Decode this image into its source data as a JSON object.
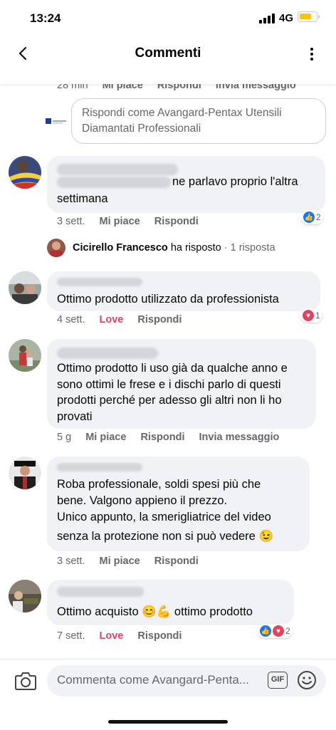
{
  "status_bar": {
    "time": "13:24",
    "network": "4G"
  },
  "header": {
    "title": "Commenti"
  },
  "top_meta": {
    "time": "28 min",
    "like": "Mi piace",
    "reply": "Rispondi",
    "message": "Invia messaggio"
  },
  "reply_as": {
    "placeholder": "Rispondi come Avangard-Pentax Utensili Diamantati Professionali"
  },
  "comments": [
    {
      "text_line1": "ne parlavo proprio l'altra",
      "text_line2": "settimana",
      "time": "3 sett.",
      "like": "Mi piace",
      "reply": "Rispondi",
      "reaction_count": "2"
    },
    {
      "text": "Ottimo prodotto utilizzato da professionista",
      "time": "4 sett.",
      "like": "Love",
      "reply": "Rispondi",
      "reaction_count": "1"
    },
    {
      "text": "Ottimo prodotto li uso già da qualche anno e sono ottimi le frese e i dischi parlo di questi prodotti perché per adesso gli altri non li ho provati",
      "time": "5 g",
      "like": "Mi piace",
      "reply": "Rispondi",
      "message": "Invia messaggio"
    },
    {
      "text_line1": "Roba professionale, soldi spesi più che",
      "text_line2": "bene. Valgono appieno il prezzo.",
      "text_line3": "Unico appunto, la smerigliatrice del video",
      "text_line4": "senza la protezione non si può vedere 😉",
      "time": "3 sett.",
      "like": "Mi piace",
      "reply": "Rispondi"
    },
    {
      "text": "Ottimo acquisto 😊💪 ottimo prodotto",
      "time": "7 sett.",
      "like": "Love",
      "reply": "Rispondi",
      "reaction_count": "2"
    }
  ],
  "replies_thread": {
    "name": "Cicirello Francesco",
    "action": "ha risposto",
    "count": "· 1 risposta"
  },
  "composer": {
    "placeholder": "Commenta come Avangard-Penta...",
    "gif": "GIF"
  },
  "colors": {
    "love": "#e4435f",
    "like_blue": "#1877f2",
    "bubble": "#f0f2f5"
  }
}
